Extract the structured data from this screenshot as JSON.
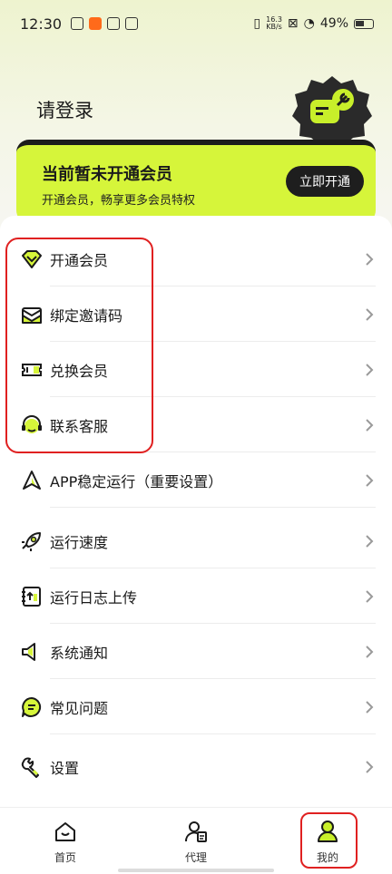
{
  "status_bar": {
    "time": "12:30",
    "net_speed_value": "16.3",
    "net_speed_unit": "KB/s",
    "battery": "49%"
  },
  "header": {
    "login_title": "请登录"
  },
  "vip_banner": {
    "title": "当前暂未开通会员",
    "subtitle": "开通会员，畅享更多会员特权",
    "button": "立即开通"
  },
  "menu": {
    "items": [
      {
        "label": "开通会员",
        "icon": "diamond-icon"
      },
      {
        "label": "绑定邀请码",
        "icon": "envelope-icon"
      },
      {
        "label": "兑换会员",
        "icon": "ticket-icon"
      },
      {
        "label": "联系客服",
        "icon": "headset-icon"
      },
      {
        "label": "APP稳定运行（重要设置）",
        "icon": "rocket-launch-icon"
      },
      {
        "label": "运行速度",
        "icon": "rocket-icon"
      },
      {
        "label": "运行日志上传",
        "icon": "log-upload-icon"
      },
      {
        "label": "系统通知",
        "icon": "speaker-icon"
      },
      {
        "label": "常见问题",
        "icon": "faq-icon"
      },
      {
        "label": "设置",
        "icon": "wrench-icon"
      }
    ]
  },
  "bottom_nav": {
    "tabs": [
      {
        "label": "首页",
        "icon": "home-icon"
      },
      {
        "label": "代理",
        "icon": "agent-icon"
      },
      {
        "label": "我的",
        "icon": "profile-icon",
        "active": true
      }
    ]
  },
  "colors": {
    "accent": "#d6f53a",
    "dark": "#1e1e1e",
    "annotation_red": "#e02020"
  }
}
